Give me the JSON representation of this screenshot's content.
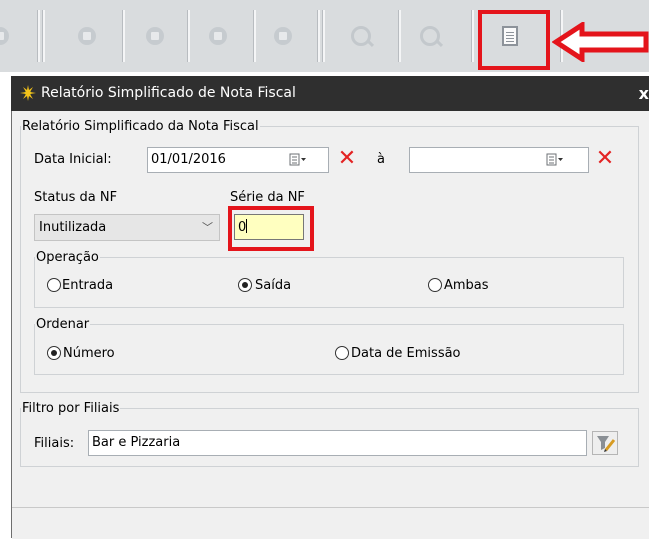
{
  "toolbar": {
    "buttons": [
      "partial-icon",
      "first-icon",
      "prev-icon",
      "next-icon",
      "last-icon",
      "search-icon",
      "search-clear-icon",
      "report-icon"
    ]
  },
  "dialog": {
    "title": "Relatório Simplificado de Nota Fiscal",
    "close_glyph": "x",
    "report_group": {
      "legend": "Relatório Simplificado da Nota Fiscal",
      "data_inicial_label": "Data Inicial:",
      "data_inicial_value": "01/01/2016",
      "ate_label": "à",
      "data_final_value": "",
      "status_label": "Status da NF",
      "status_value": "Inutilizada",
      "serie_label": "Série da NF",
      "serie_value": "0",
      "operacao": {
        "legend": "Operação",
        "options": [
          "Entrada",
          "Saída",
          "Ambas"
        ],
        "selected": "Saída"
      },
      "ordenar": {
        "legend": "Ordenar",
        "options": [
          "Número",
          "Data de Emissão"
        ],
        "selected": "Número"
      }
    },
    "filter_group": {
      "legend": "Filtro por Filiais",
      "filiais_label": "Filiais:",
      "filiais_value": "Bar e Pizzaria"
    }
  },
  "colors": {
    "highlight": "#e4141b",
    "serie_bg": "#ffffc0",
    "titlebar": "#2f2f2f"
  }
}
